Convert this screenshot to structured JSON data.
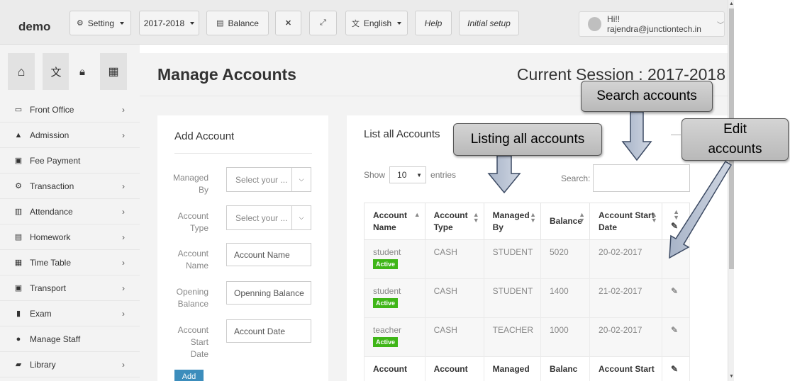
{
  "topbar": {
    "brand": "demo",
    "setting_label": "Setting",
    "session_label": "2017-2018",
    "balance_label": "Balance",
    "language_label": "English",
    "help_label": "Help",
    "initial_setup_label": "Initial setup",
    "user_label": "Hi!! rajendra@junctiontech.in"
  },
  "sidebar": {
    "items": [
      {
        "label": "Front Office",
        "icon": "monitor-icon",
        "has_chevron": true
      },
      {
        "label": "Admission",
        "icon": "graduation-cap-icon",
        "has_chevron": true
      },
      {
        "label": "Fee Payment",
        "icon": "money-icon",
        "has_chevron": false
      },
      {
        "label": "Transaction",
        "icon": "cog-icon",
        "has_chevron": true
      },
      {
        "label": "Attendance",
        "icon": "bar-chart-icon",
        "has_chevron": true
      },
      {
        "label": "Homework",
        "icon": "document-icon",
        "has_chevron": true
      },
      {
        "label": "Time Table",
        "icon": "calendar-icon",
        "has_chevron": true
      },
      {
        "label": "Transport",
        "icon": "bus-icon",
        "has_chevron": true
      },
      {
        "label": "Exam",
        "icon": "file-icon",
        "has_chevron": true
      },
      {
        "label": "Manage Staff",
        "icon": "users-icon",
        "has_chevron": false
      },
      {
        "label": "Library",
        "icon": "book-icon",
        "has_chevron": true
      }
    ]
  },
  "header": {
    "title": "Manage Accounts",
    "session": "Current Session : 2017-2018"
  },
  "add_account": {
    "title": "Add Account",
    "managed_by_label": "Managed By",
    "managed_by_placeholder": "Select your ...",
    "account_type_label": "Account Type",
    "account_type_placeholder": "Select your ...",
    "account_name_label": "Account Name",
    "account_name_placeholder": "Account Name",
    "opening_balance_label": "Opening Balance",
    "opening_balance_placeholder": "Openning Balance",
    "account_start_date_label": "Account Start Date",
    "account_start_date_placeholder": "Account Date",
    "add_button": "Add"
  },
  "list": {
    "title": "List all Accounts",
    "show_label": "Show",
    "entries_label": "entries",
    "page_length": "10",
    "search_label": "Search:",
    "columns": [
      "Account Name",
      "Account Type",
      "Managed By",
      "Balance",
      "Account Start Date"
    ],
    "rows": [
      {
        "name": "student",
        "status": "Active",
        "type": "CASH",
        "managed_by": "STUDENT",
        "balance": "5020",
        "start_date": "20-02-2017"
      },
      {
        "name": "student",
        "status": "Active",
        "type": "CASH",
        "managed_by": "STUDENT",
        "balance": "1400",
        "start_date": "21-02-2017"
      },
      {
        "name": "teacher",
        "status": "Active",
        "type": "CASH",
        "managed_by": "TEACHER",
        "balance": "1000",
        "start_date": "20-02-2017"
      }
    ],
    "footer": [
      "Account",
      "Account",
      "Managed",
      "Balanc",
      "Account Start"
    ]
  },
  "annotations": {
    "search": "Search accounts",
    "listing": "Listing all accounts",
    "edit": "Edit accounts"
  }
}
